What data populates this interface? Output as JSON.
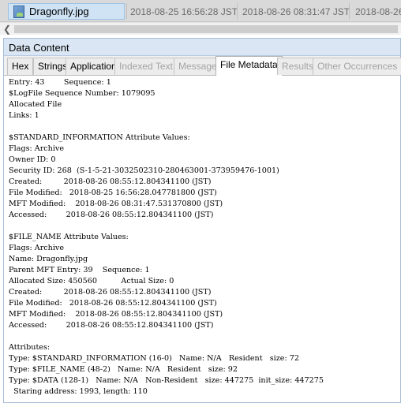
{
  "file_row": {
    "name": "Dragonfly.jpg",
    "date1": "2018-08-25 16:56:28 JST",
    "date2": "2018-08-26 08:31:47 JST",
    "date3": "2018-08-26"
  },
  "panel": {
    "title": "Data Content"
  },
  "tabs": [
    {
      "label": "Hex",
      "state": "enabled"
    },
    {
      "label": "Strings",
      "state": "enabled"
    },
    {
      "label": "Application",
      "state": "enabled"
    },
    {
      "label": "Indexed Text",
      "state": "disabled"
    },
    {
      "label": "Message",
      "state": "disabled"
    },
    {
      "label": "File Metadata",
      "state": "active"
    },
    {
      "label": "Results",
      "state": "disabled"
    },
    {
      "label": "Other Occurrences",
      "state": "disabled"
    }
  ],
  "metadata_lines": [
    "Entry: 43        Sequence: 1",
    "$LogFile Sequence Number: 1079095",
    "Allocated File",
    "Links: 1",
    "",
    "$STANDARD_INFORMATION Attribute Values:",
    "Flags: Archive",
    "Owner ID: 0",
    "Security ID: 268  (S-1-5-21-3032502310-280463001-373959476-1001)",
    "Created:         2018-08-26 08:55:12.804341100 (JST)",
    "File Modified:   2018-08-25 16:56:28.047781800 (JST)",
    "MFT Modified:    2018-08-26 08:31:47.531370800 (JST)",
    "Accessed:        2018-08-26 08:55:12.804341100 (JST)",
    "",
    "$FILE_NAME Attribute Values:",
    "Flags: Archive",
    "Name: Dragonfly.jpg",
    "Parent MFT Entry: 39    Sequence: 1",
    "Allocated Size: 450560          Actual Size: 0",
    "Created:         2018-08-26 08:55:12.804341100 (JST)",
    "File Modified:   2018-08-26 08:55:12.804341100 (JST)",
    "MFT Modified:    2018-08-26 08:55:12.804341100 (JST)",
    "Accessed:        2018-08-26 08:55:12.804341100 (JST)",
    "",
    "Attributes:",
    "Type: $STANDARD_INFORMATION (16-0)   Name: N/A   Resident   size: 72",
    "Type: $FILE_NAME (48-2)   Name: N/A   Resident   size: 92",
    "Type: $DATA (128-1)   Name: N/A   Non-Resident   size: 447275  init_size: 447275",
    "  Staring address: 1993, length: 110"
  ]
}
